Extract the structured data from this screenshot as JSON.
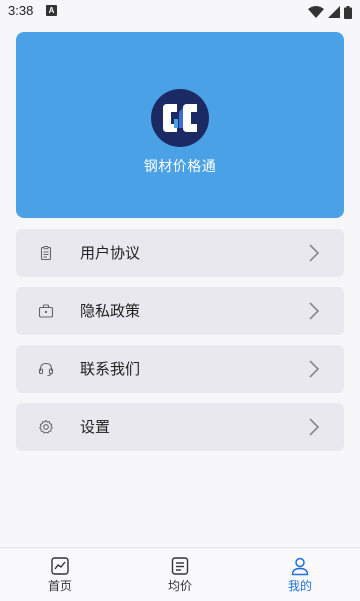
{
  "status_bar": {
    "time": "3:38",
    "notification_icon": "a-notification-icon",
    "wifi_icon": "wifi-icon",
    "signal_icon": "signal-icon",
    "battery_icon": "battery-icon"
  },
  "banner": {
    "app_name": "钢材价格通",
    "background_color": "#4aa1e5",
    "logo_icon": "gc-logo-icon"
  },
  "menu": [
    {
      "label": "用户协议",
      "icon": "clipboard-icon"
    },
    {
      "label": "隐私政策",
      "icon": "briefcase-icon"
    },
    {
      "label": "联系我们",
      "icon": "headset-icon"
    },
    {
      "label": "设置",
      "icon": "gear-icon"
    }
  ],
  "tabbar": {
    "active_color": "#1e6fdc",
    "tabs": [
      {
        "label": "首页",
        "icon": "chart-icon",
        "active": false
      },
      {
        "label": "均价",
        "icon": "list-icon",
        "active": false
      },
      {
        "label": "我的",
        "icon": "user-icon",
        "active": true
      }
    ]
  }
}
